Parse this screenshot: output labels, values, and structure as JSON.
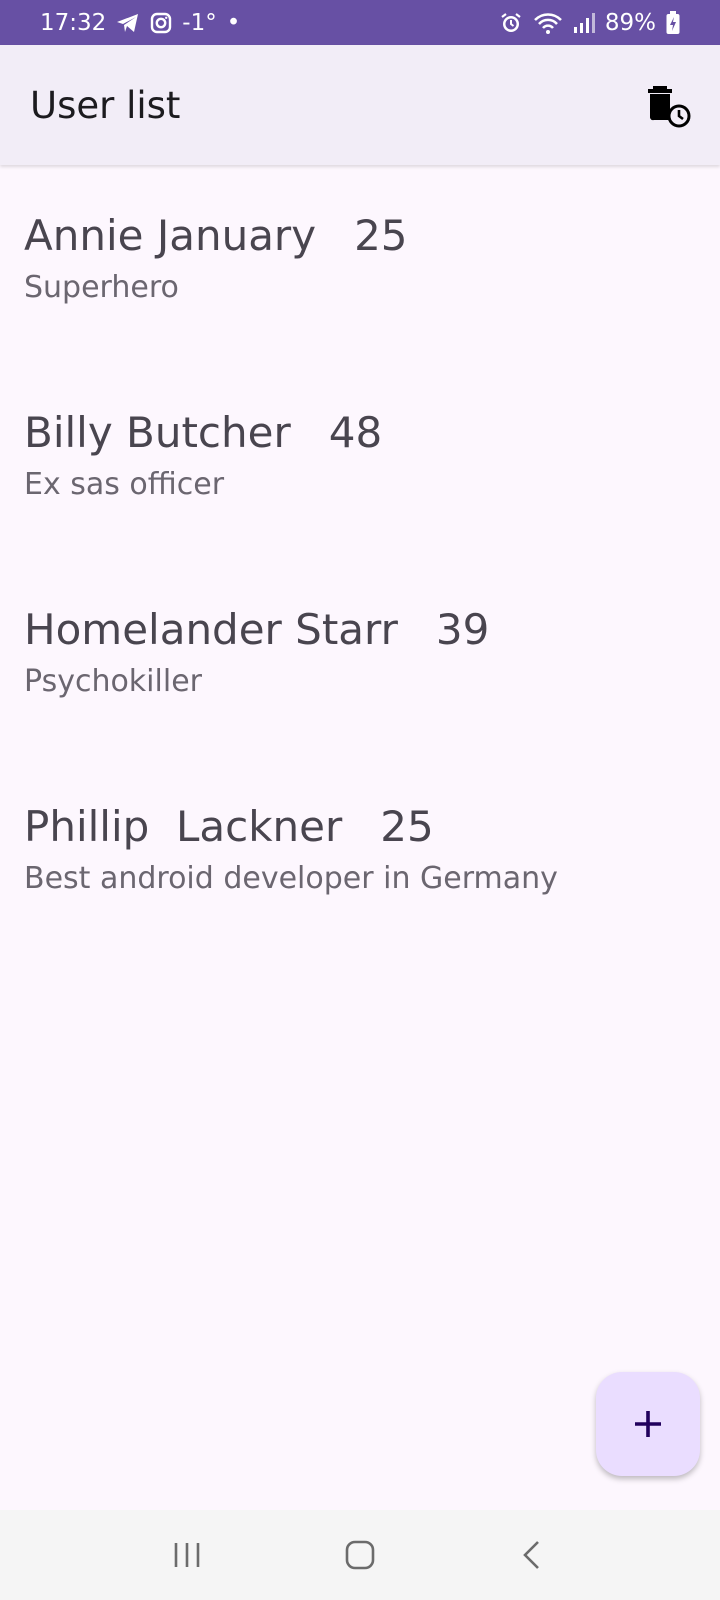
{
  "status_bar": {
    "time": "17:32",
    "temperature": "-1°",
    "dot": "•",
    "battery": "89%",
    "icons": [
      "telegram-icon",
      "instagram-icon",
      "alarm-icon",
      "wifi-icon",
      "signal-icon",
      "battery-icon"
    ]
  },
  "app_bar": {
    "title": "User list",
    "action_icon": "delete-history-icon"
  },
  "users": [
    {
      "name": "Annie January",
      "age": "25",
      "description": "Superhero"
    },
    {
      "name": "Billy Butcher",
      "age": "48",
      "description": "Ex sas officer"
    },
    {
      "name": "Homelander Starr",
      "age": "39",
      "description": "Psychokiller"
    },
    {
      "name": "Phillip  Lackner",
      "age": "25",
      "description": "Best android developer in Germany"
    }
  ],
  "fab": {
    "icon": "plus-icon"
  },
  "nav_bar": {
    "icons": [
      "recent-apps-icon",
      "home-icon",
      "back-icon"
    ]
  },
  "colors": {
    "status_bar": "#6750a4",
    "app_bar": "#f2edf7",
    "background": "#fdf7fe",
    "fab": "#eaddff",
    "fab_icon": "#21005d"
  }
}
